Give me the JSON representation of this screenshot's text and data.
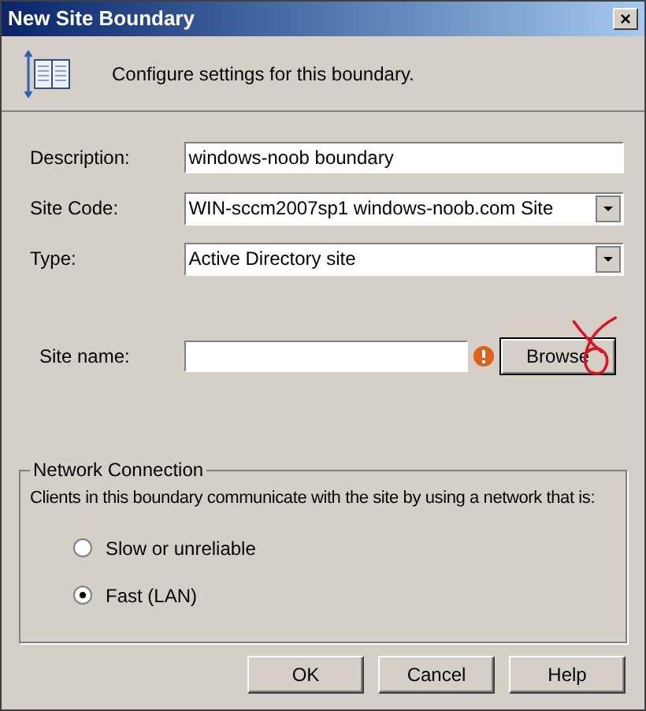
{
  "window": {
    "title": "New Site Boundary",
    "close": "×"
  },
  "header": {
    "text": "Configure settings for this boundary."
  },
  "fields": [
    {
      "kind": "text",
      "label": "Description:",
      "value": "windows-noob boundary"
    },
    {
      "kind": "dropdown",
      "label": "Site Code:",
      "value": "WIN-sccm2007sp1 windows-noob.com Site"
    },
    {
      "kind": "dropdown",
      "label": "Type:",
      "value": "Active Directory site"
    }
  ],
  "site_name": {
    "label": "Site name:",
    "warning": true,
    "button": "Browse"
  },
  "network": {
    "title": "Network Connection",
    "text": "Clients in this boundary communicate with the site by using a network that is:",
    "options": [
      {
        "label": "Slow or unreliable",
        "selected": false
      },
      {
        "label": "Fast (LAN)",
        "selected": true
      }
    ]
  },
  "buttons": [
    "OK",
    "Cancel",
    "Help"
  ]
}
